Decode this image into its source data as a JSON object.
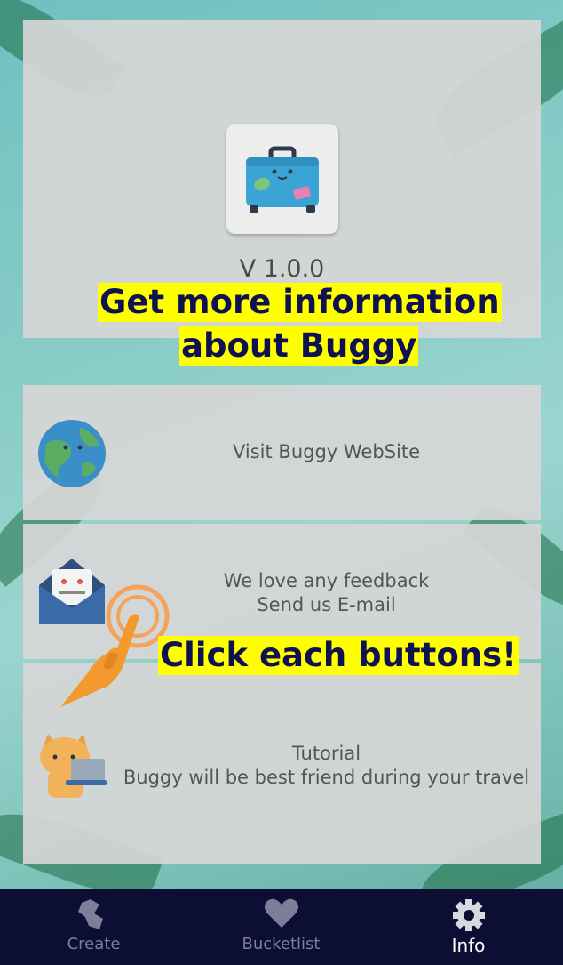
{
  "app": {
    "version": "V 1.0.0"
  },
  "overlay": {
    "info_line1": "Get more information",
    "info_line2": "about Buggy",
    "click_hint": "Click each buttons!"
  },
  "rows": [
    {
      "line1": "Visit Buggy WebSite",
      "line2": "",
      "icon": "globe-icon"
    },
    {
      "line1": "We love any feedback",
      "line2": "Send us E-mail",
      "icon": "envelope-icon"
    },
    {
      "line1": "Tutorial",
      "line2": "Buggy will be best friend during your travel",
      "icon": "cat-laptop-icon"
    }
  ],
  "tabs": [
    {
      "label": "Create",
      "icon": "map-icon"
    },
    {
      "label": "Bucketlist",
      "icon": "heart-icon"
    },
    {
      "label": "Info",
      "icon": "gear-icon",
      "active": true
    }
  ],
  "colors": {
    "tabbar": "#0c0f33",
    "highlight": "#ffff00",
    "highlight_text": "#0e1250"
  }
}
